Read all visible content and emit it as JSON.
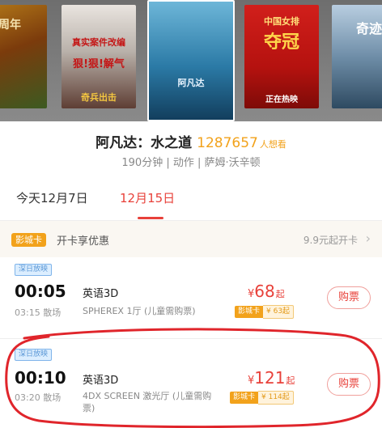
{
  "posters": [
    {
      "id": "p1",
      "text": "周年"
    },
    {
      "id": "p2",
      "text_top": "真实案件改编",
      "text_mid": "狠!狠!解气",
      "text_bot": "奇兵出击"
    },
    {
      "id": "p3",
      "text": "阿凡达"
    },
    {
      "id": "p4",
      "text_top": "中国女排",
      "text_mid": "夺冠",
      "text_bot": "正在热映"
    },
    {
      "id": "p5",
      "text": "奇迹"
    }
  ],
  "movie": {
    "title": "阿凡达：水之道",
    "want_count": "1287657",
    "want_suffix": "人想看",
    "meta": "190分钟 | 动作 | 萨姆·沃辛顿"
  },
  "date_tabs": [
    {
      "label": "今天12月7日",
      "active": false
    },
    {
      "label": "12月15日",
      "active": true
    }
  ],
  "promo": {
    "badge": "影城卡",
    "text": "开卡享优惠",
    "right": "9.9元起开卡",
    "arrow": "›"
  },
  "showtimes": [
    {
      "tag": "深日放映",
      "start": "00:05",
      "end": "03:15 散场",
      "lang": "英语3D",
      "hall": "SPHEREX 1厅 (儿童需购票)",
      "currency": "¥",
      "price": "68",
      "price_suffix": "起",
      "card_label": "影城卡",
      "card_price": "¥ 63起",
      "buy": "购票"
    },
    {
      "tag": "深日放映",
      "start": "00:10",
      "end": "03:20 散场",
      "lang": "英语3D",
      "hall": "4DX SCREEN 激光厅 (儿童需购票)",
      "currency": "¥",
      "price": "121",
      "price_suffix": "起",
      "card_label": "影城卡",
      "card_price": "¥ 114起",
      "buy": "购票"
    }
  ],
  "colors": {
    "accent": "#e8413a",
    "orange": "#f2a21b",
    "annotation": "#e0252b"
  }
}
